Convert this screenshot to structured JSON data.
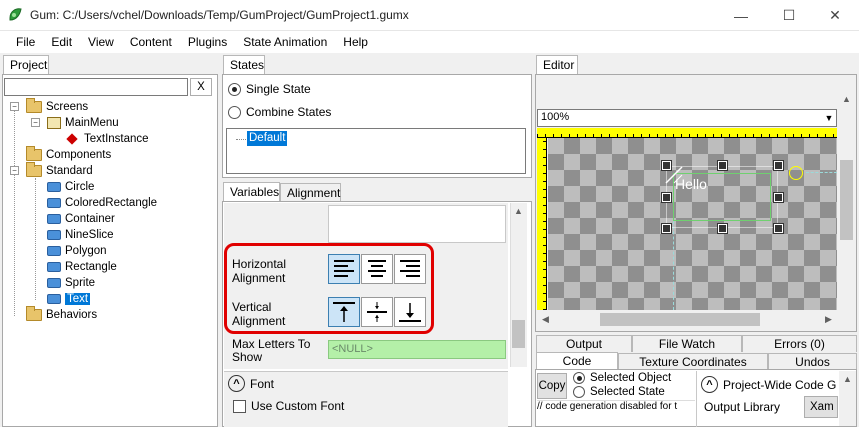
{
  "window": {
    "title": "Gum: C:/Users/vchel/Downloads/Temp/GumProject/GumProject1.gumx",
    "minimize_glyph": "—",
    "maximize_glyph": "☐",
    "close_glyph": "✕"
  },
  "menu": [
    "File",
    "Edit",
    "View",
    "Content",
    "Plugins",
    "State Animation",
    "Help"
  ],
  "project": {
    "tab": "Project",
    "search_placeholder": "",
    "clear_label": "X",
    "tree": {
      "screens": "Screens",
      "main_menu": "MainMenu",
      "text_instance": "TextInstance",
      "components": "Components",
      "standard": "Standard",
      "standard_items": [
        "Circle",
        "ColoredRectangle",
        "Container",
        "NineSlice",
        "Polygon",
        "Rectangle",
        "Sprite",
        "Text"
      ],
      "behaviors": "Behaviors"
    }
  },
  "states": {
    "tab": "States",
    "single_state": "Single State",
    "combine_states": "Combine States",
    "default_state": "Default"
  },
  "variables": {
    "tab_variables": "Variables",
    "tab_alignment": "Alignment",
    "horizontal_alignment": [
      "Horizontal",
      "Alignment"
    ],
    "vertical_alignment": [
      "Vertical",
      "Alignment"
    ],
    "max_letters": [
      "Max Letters To",
      "Show"
    ],
    "max_letters_value": "<NULL>",
    "font_section": "Font",
    "use_custom_font": "Use Custom Font",
    "collapse_glyph": "^"
  },
  "editor": {
    "tab": "Editor",
    "zoom": "100%",
    "hello_text": "Hello"
  },
  "bottom": {
    "tabs_row1": [
      "Output",
      "File Watch",
      "Errors (0)"
    ],
    "tabs_row2": [
      "Code",
      "Texture Coordinates",
      "Undos"
    ],
    "copy_label": "Copy",
    "selected_object": "Selected Object",
    "selected_state": "Selected State",
    "code_text": "// code generation disabled for t",
    "project_wide": "Project-Wide Code G",
    "output_library": "Output Library",
    "xam_label": "Xam"
  },
  "colors": {
    "highlight_red": "#e00000",
    "selection_blue": "#0078d7",
    "ruler_yellow": "#ffff00",
    "null_field_green": "#b4f0a8"
  }
}
